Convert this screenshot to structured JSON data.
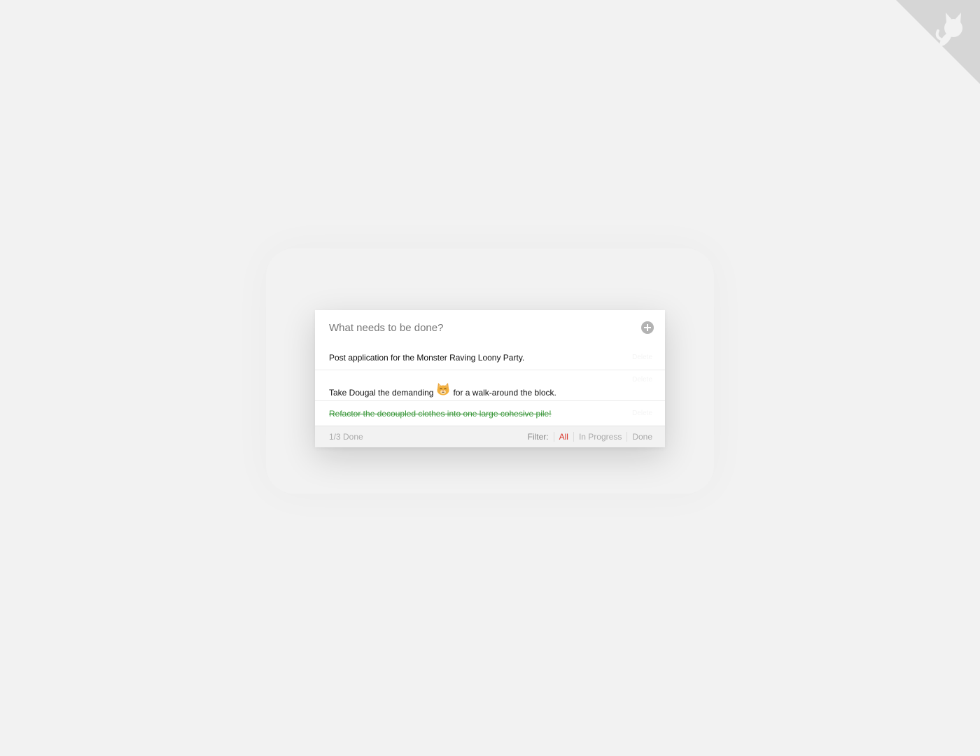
{
  "new_todo": {
    "placeholder": "What needs to be done?"
  },
  "todos": [
    {
      "text": "Post application for the Monster Raving Loony Party.",
      "done": false,
      "delete_label": "Delete"
    },
    {
      "text_before": "Take Dougal the demanding",
      "emoji": "cat-face",
      "text_after": "for a walk-around the block.",
      "done": false,
      "delete_label": "Delete"
    },
    {
      "text": "Refactor the decoupled clothes into one large cohesive pile!",
      "done": true,
      "delete_label": "Delete"
    }
  ],
  "footer": {
    "count": "1/3 Done",
    "filter_label": "Filter:",
    "filters": [
      "All",
      "In Progress",
      "Done"
    ],
    "active_filter": "All"
  },
  "colors": {
    "background": "#f2f2f2",
    "done_text": "#3a9a3a",
    "active_filter": "#d9352b"
  },
  "icons": {
    "add": "plus-circle-icon",
    "corner": "github-octocat-icon"
  }
}
